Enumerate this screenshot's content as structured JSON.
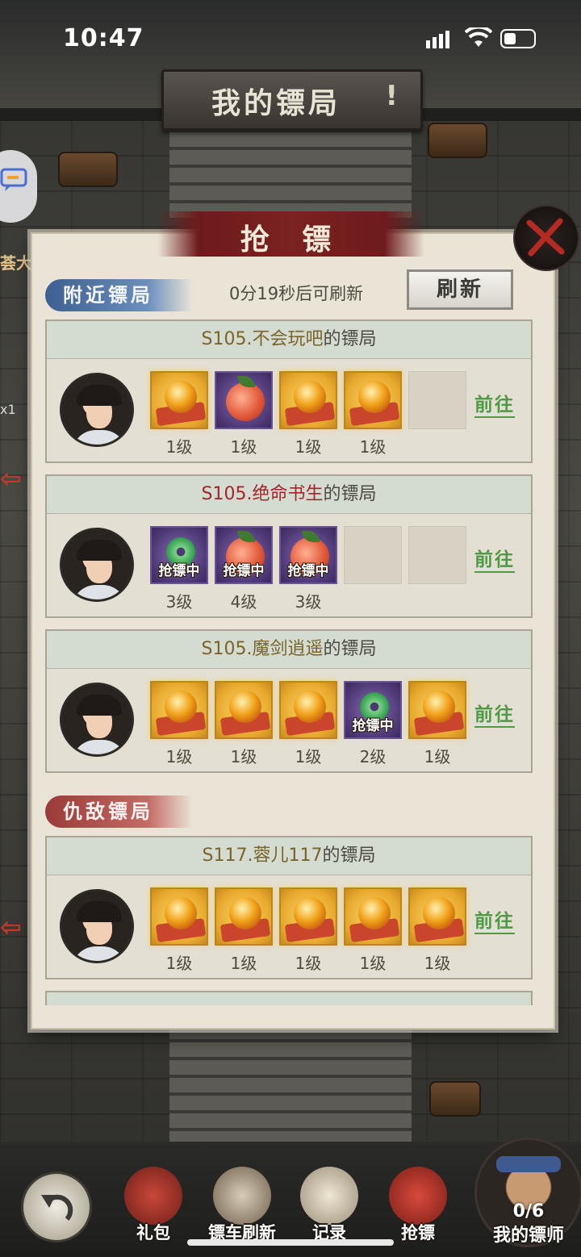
{
  "status_bar": {
    "time": "10:47"
  },
  "signboard": {
    "title": "我的镖局",
    "mark": "!"
  },
  "side": {
    "fragment_a": "荟大",
    "fragment_b": "x1"
  },
  "panel": {
    "title": "抢 镖",
    "nearby_tag": "附近镖局",
    "refresh_countdown": "0分19秒后可刷新",
    "refresh_button": "刷新",
    "enemy_tag": "仇敌镖局",
    "goto_label": "前往"
  },
  "nearby": [
    {
      "server": "S105.",
      "name": "不会玩吧",
      "suffix": "的镖局",
      "name_color": "gold",
      "slots": [
        {
          "type": "gold",
          "item": "orb",
          "level": "1级"
        },
        {
          "type": "purple",
          "item": "peach",
          "level": "1级"
        },
        {
          "type": "gold",
          "item": "orb",
          "level": "1级"
        },
        {
          "type": "gold",
          "item": "orb",
          "level": "1级"
        },
        {
          "type": "empty"
        }
      ]
    },
    {
      "server": "S105.",
      "name": "绝命书生",
      "suffix": "的镖局",
      "name_color": "red",
      "slots": [
        {
          "type": "purple",
          "item": "jade",
          "badge": "抢镖中",
          "level": "3级"
        },
        {
          "type": "purple",
          "item": "peach",
          "badge": "抢镖中",
          "level": "4级"
        },
        {
          "type": "purple",
          "item": "peach",
          "badge": "抢镖中",
          "level": "3级"
        },
        {
          "type": "empty"
        },
        {
          "type": "empty"
        }
      ]
    },
    {
      "server": "S105.",
      "name": "魔剑逍遥",
      "suffix": "的镖局",
      "name_color": "gold",
      "slots": [
        {
          "type": "gold",
          "item": "orb",
          "level": "1级"
        },
        {
          "type": "gold",
          "item": "orb",
          "level": "1级"
        },
        {
          "type": "gold",
          "item": "orb",
          "level": "1级"
        },
        {
          "type": "purple",
          "item": "jade",
          "badge": "抢镖中",
          "level": "2级"
        },
        {
          "type": "gold",
          "item": "orb",
          "level": "1级"
        }
      ]
    }
  ],
  "enemies": [
    {
      "server": "S117.",
      "name": "蓉儿117",
      "suffix": "的镖局",
      "name_color": "gold",
      "slots": [
        {
          "type": "gold",
          "item": "orb",
          "level": "1级"
        },
        {
          "type": "gold",
          "item": "orb",
          "level": "1级"
        },
        {
          "type": "gold",
          "item": "orb",
          "level": "1级"
        },
        {
          "type": "gold",
          "item": "orb",
          "level": "1级"
        },
        {
          "type": "gold",
          "item": "orb",
          "level": "1级"
        }
      ]
    }
  ],
  "bottom_nav": {
    "items": [
      "礼包",
      "镖车刷新",
      "记录",
      "抢镖"
    ],
    "coach_count": "0/6",
    "coach_label": "我的镖师"
  }
}
